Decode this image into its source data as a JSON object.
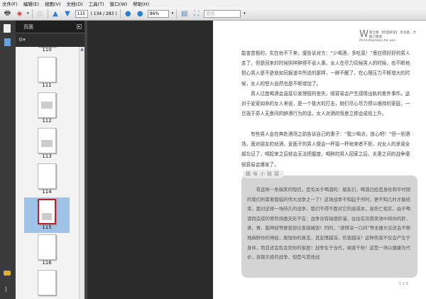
{
  "menu": [
    "文件(F)",
    "编辑(E)",
    "视图(V)",
    "文档(D)",
    "工具(T)",
    "窗口(W)",
    "帮助(H)"
  ],
  "toolbar": {
    "page_input": "115",
    "page_count": "( 134 / 283 )",
    "zoom": "86%",
    "search_placeholder": "查找"
  },
  "panel": {
    "title": "页面"
  },
  "thumbnails": [
    {
      "label": "110"
    },
    {
      "label": "111"
    },
    {
      "label": "112"
    },
    {
      "label": "113"
    },
    {
      "label": "114"
    },
    {
      "label": "115",
      "selected": true
    },
    {
      "label": "116"
    }
  ],
  "document": {
    "header_letter": "W",
    "header_line1": "第七章 【饮酒杂谈】 务注意，才能少喝酒",
    "header_line2": "ife Instructions for use",
    "paragraphs": [
      "能害苦根的，实在劝不下来，便告诉对方：“少喝酒，多吃菜！”意应得好好的男人走了，但是回来的时候照样醉得不省人事。女人在尽力伺候男人的时候，也不断地担心男人是不是就如同报道中所说的那样，一醉不醒了。在心理压力不断增大的时候，女人的怒火自然也是不断增加了。",
      "　　男人过度喝酒会直接引发理智的丧失，很容易会产生感情出轨的意外事件。这对于爱家如命的女人来说，是一个极大的打击，她们尽心尽力得以维持的家庭，一旦毁于男人无意间的醉酒行为的话，女人对酒的恨意立即会成倍上升。",
      "　　有些男人会在奔赴酒场之前告诉自己的妻子：“我少喝点，放心吧！”但一到酒场，面对朋友的劝酒，爱面子的男人便会一杯接一杯地来者不拒，对女人的承诺全部忘记了，喝起来之后就会无法把握度，喝醉的男人回家之后，夫妻之间的战争便很容易会爆发了。"
    ],
    "box_title": "趣味小链接",
    "box_text": "　　有这样一条搞笑的短信，是有关于喝酒的：朋友们，喝酒已经是身处和平时期的我们所需要面临的伟大战争之一了！这场战争不知起于何时，更不知几时才能结束，面对这样一场持久的战争，我们不得不面对它的高成本，高伤亡现实，由于喝酒而造成的惨烈场面无处不在：战争没有硝烟弥漫，往往在欢歌笑语中将你的肝、肾、胃、脑神经等要害部位直接摧毁！同时，“感情深一口闷”等无厘头论还会不断地麻醉你的神经，腐蚀你的意志，其友情越深，伤害越深！这种伤害不仅会产生于身体，而且还会危及到你的家庭！战争生于当代，祸害千秋！这是一场以健康为代价，自我灭绝的战争，但是与其他战",
    "page_number": "1 1 9"
  }
}
